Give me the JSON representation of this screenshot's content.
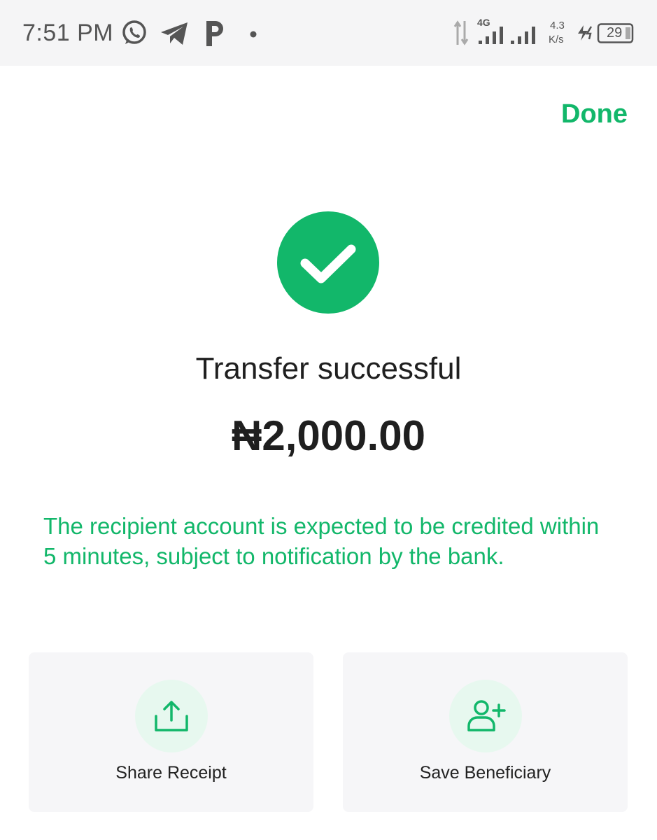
{
  "status_bar": {
    "time": "7:51 PM",
    "network_type": "4G",
    "speed_value": "4.3",
    "speed_unit": "K/s",
    "battery": "29",
    "icons": [
      "whatsapp-icon",
      "telegram-icon",
      "p-app-icon",
      "notification-dot-icon",
      "data-arrows-icon",
      "signal-icon",
      "signal-icon",
      "charging-icon",
      "battery-icon"
    ]
  },
  "header": {
    "done_label": "Done"
  },
  "result": {
    "icon": "checkmark-icon",
    "title": "Transfer successful",
    "amount": "₦2,000.00",
    "notice": "The recipient account is expected to be credited within 5 minutes, subject to notification by the bank."
  },
  "actions": [
    {
      "label": "Share Receipt",
      "icon": "share-icon"
    },
    {
      "label": "Save Beneficiary",
      "icon": "add-user-icon"
    }
  ],
  "colors": {
    "accent": "#12b76a",
    "accent_light": "#e7f8ef",
    "card_bg": "#f6f6f8",
    "text": "#1f1f1f"
  }
}
